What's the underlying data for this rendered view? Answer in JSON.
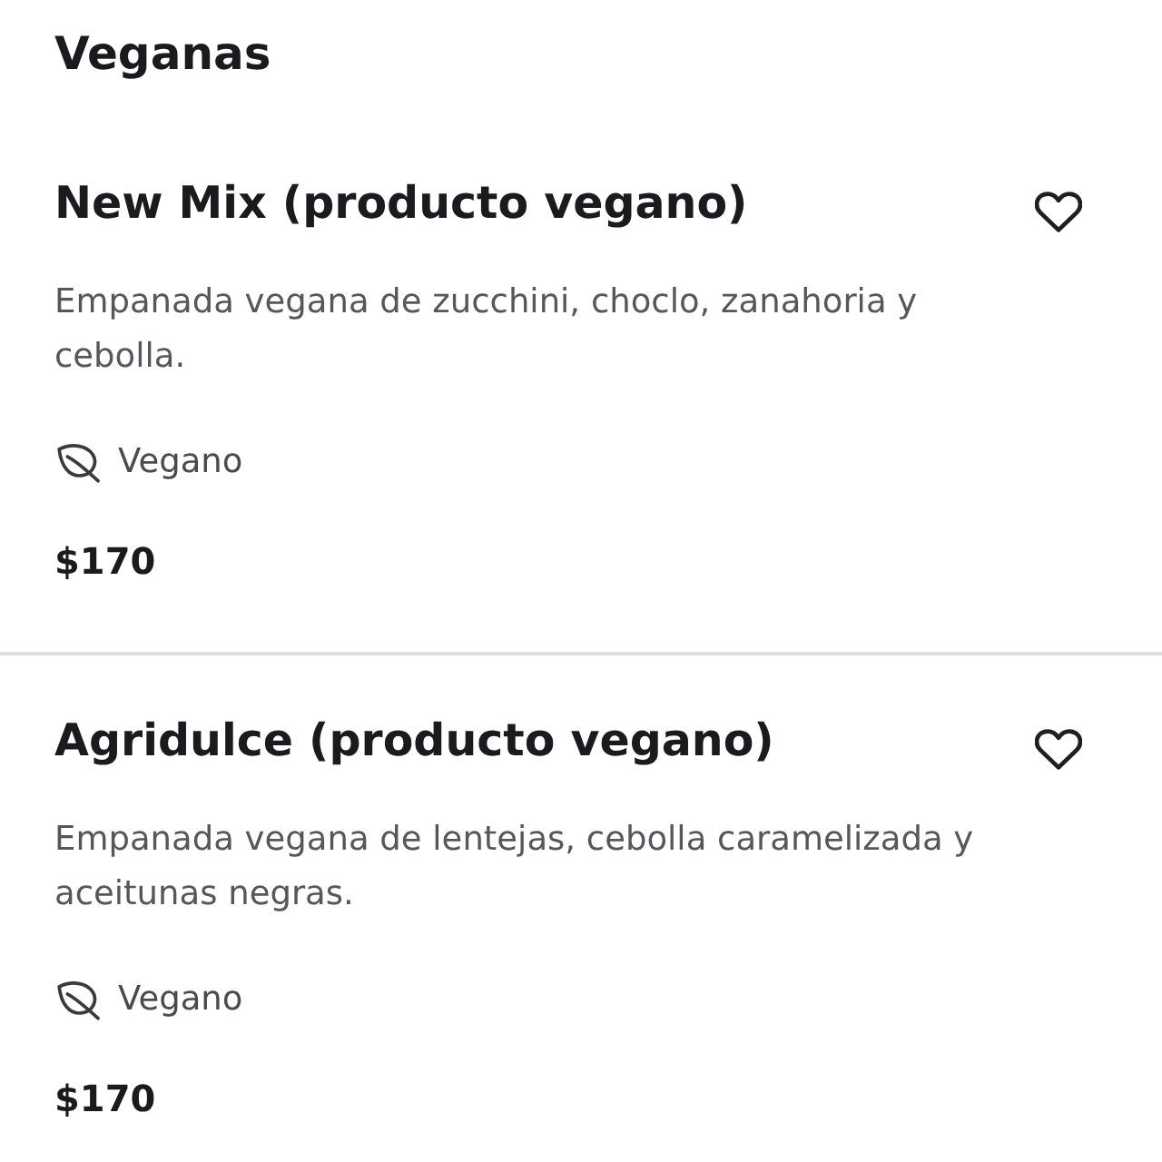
{
  "section": {
    "title": "Veganas"
  },
  "products": [
    {
      "name": "New Mix (producto vegano)",
      "favorited": false,
      "description": "Empanada vegana de zucchini, choclo, zanahoria y cebolla.",
      "tags": [
        {
          "label": "Vegano"
        }
      ],
      "price": "$170"
    },
    {
      "name": "Agridulce (producto vegano)",
      "favorited": false,
      "description": "Empanada vegana de lentejas, cebolla caramelizada y aceitunas negras.",
      "tags": [
        {
          "label": "Vegano"
        }
      ],
      "price": "$170"
    }
  ]
}
